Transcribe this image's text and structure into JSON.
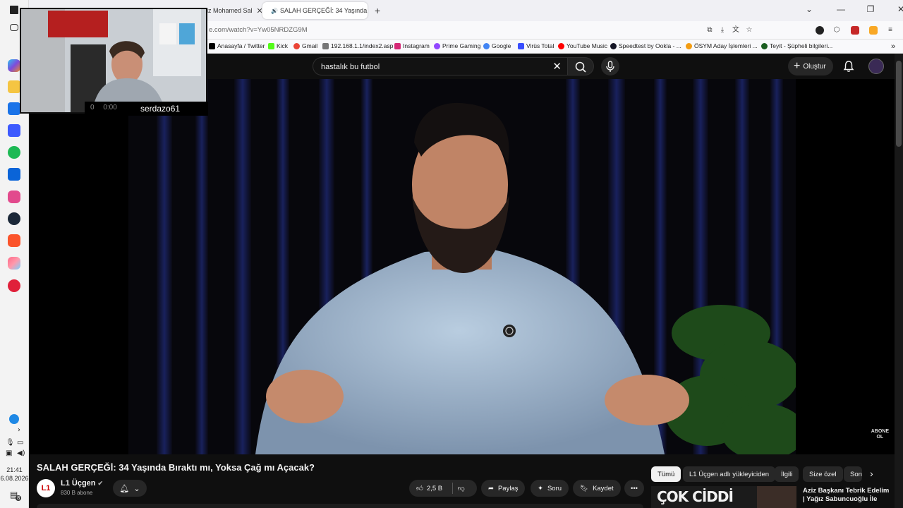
{
  "taskbar": {
    "icons": [
      "widgets-icon",
      "copilot-icon",
      "file-explorer-icon",
      "microsoft-store-icon",
      "app-snowflake-icon",
      "spotify-icon",
      "outlook-icon",
      "game-launcher-icon",
      "steam-icon",
      "brave-icon",
      "photos-icon",
      "media-icon"
    ],
    "time": "21:41",
    "date": "6.08.2026",
    "notification_count": "8"
  },
  "browser": {
    "tabs": [
      {
        "label": "iz Mohamed Sal"
      },
      {
        "label": "SALAH GERÇEĞİ: 34 Yaşında"
      }
    ],
    "url": "e.com/watch?v=Yw05NRDZG9M",
    "bookmarks": [
      "Anasayfa / Twitter",
      "Kick",
      "Gmail",
      "192.168.1.1/index2.asp",
      "Instagram",
      "Prime Gaming",
      "Google",
      "Virüs Total",
      "YouTube Music",
      "Speedtest by Ookla - ...",
      "ÖSYM Aday İşlemleri ...",
      "Teyit - Şüpheli bilgileri..."
    ]
  },
  "youtube": {
    "search_value": "hastalık bu futbol",
    "create_label": "Oluştur",
    "video_title": "SALAH GERÇEĞİ: 34 Yaşında Bıraktı mı, Yoksa Çağ mı Açacak?",
    "watermark": "ABONE\nOL",
    "channel": {
      "logo": "L1",
      "name": "L1 Üçgen",
      "subscribers": "830 B abone"
    },
    "actions": {
      "likes": "2,5 B",
      "share": "Paylaş",
      "ask": "Soru",
      "save": "Kaydet"
    },
    "chips": [
      "Tümü",
      "L1 Üçgen adlı yükleyiciden",
      "İlgili",
      "Size özel",
      "Son"
    ],
    "recommendation": {
      "thumb_text": "ÇOK CİDDİ",
      "title": "Aziz Başkanı Tebrik Edelim | Yağız Sabuncuoğlu İle"
    }
  },
  "stream": {
    "username": "serdazo61",
    "viewers": "0",
    "timer": "0:00"
  }
}
